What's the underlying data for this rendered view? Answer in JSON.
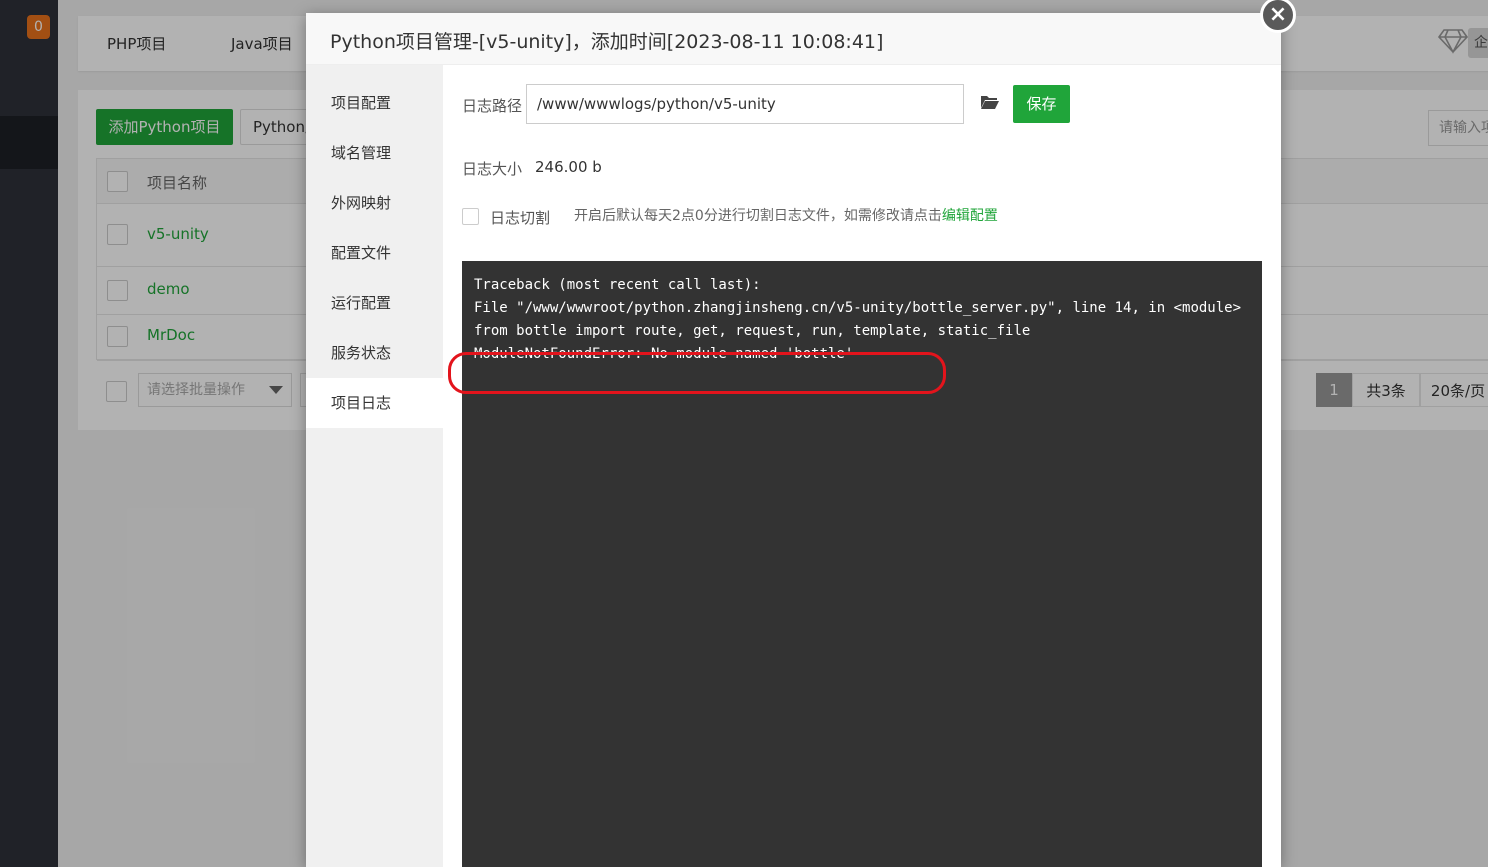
{
  "sidebar": {
    "badge": "0"
  },
  "topbar": {
    "tabs": [
      "PHP项目",
      "Java项目"
    ],
    "enterprise_label": "企"
  },
  "toolbar": {
    "add_label": "添加Python项目",
    "version_label": "Python版",
    "search_placeholder": "请输入项"
  },
  "table": {
    "header": "项目名称",
    "rows": [
      {
        "name": "v5-unity"
      },
      {
        "name": "demo"
      },
      {
        "name": "MrDoc"
      }
    ]
  },
  "footer": {
    "batch_placeholder": "请选择批量操作",
    "current_page": "1",
    "total": "共3条",
    "per_page": "20条/页"
  },
  "modal": {
    "title": "Python项目管理-[v5-unity]，添加时间[2023-08-11 10:08:41]",
    "close": "×",
    "menu": [
      "项目配置",
      "域名管理",
      "外网映射",
      "配置文件",
      "运行配置",
      "服务状态",
      "项目日志"
    ],
    "active_menu": "项目日志",
    "log_path_label": "日志路径",
    "log_path": "/www/wwwlogs/python/v5-unity",
    "save_label": "保存",
    "log_size_label": "日志大小",
    "log_size": "246.00 b",
    "cut_label": "日志切割",
    "cut_hint": "开启后默认每天2点0分进行切割日志文件，如需修改请点击",
    "cut_hint_link": "编辑配置",
    "log_lines": [
      "Traceback (most recent call last):",
      "File \"/www/wwwroot/python.zhangjinsheng.cn/v5-unity/bottle_server.py\", line 14, in <module>",
      "from bottle import route, get, request, run, template, static_file",
      "ModuleNotFoundError: No module named 'bottle'"
    ]
  },
  "colors": {
    "accent": "#20a53a",
    "badge": "#e8711c",
    "highlight": "#e3141c",
    "log_bg": "#333333"
  }
}
